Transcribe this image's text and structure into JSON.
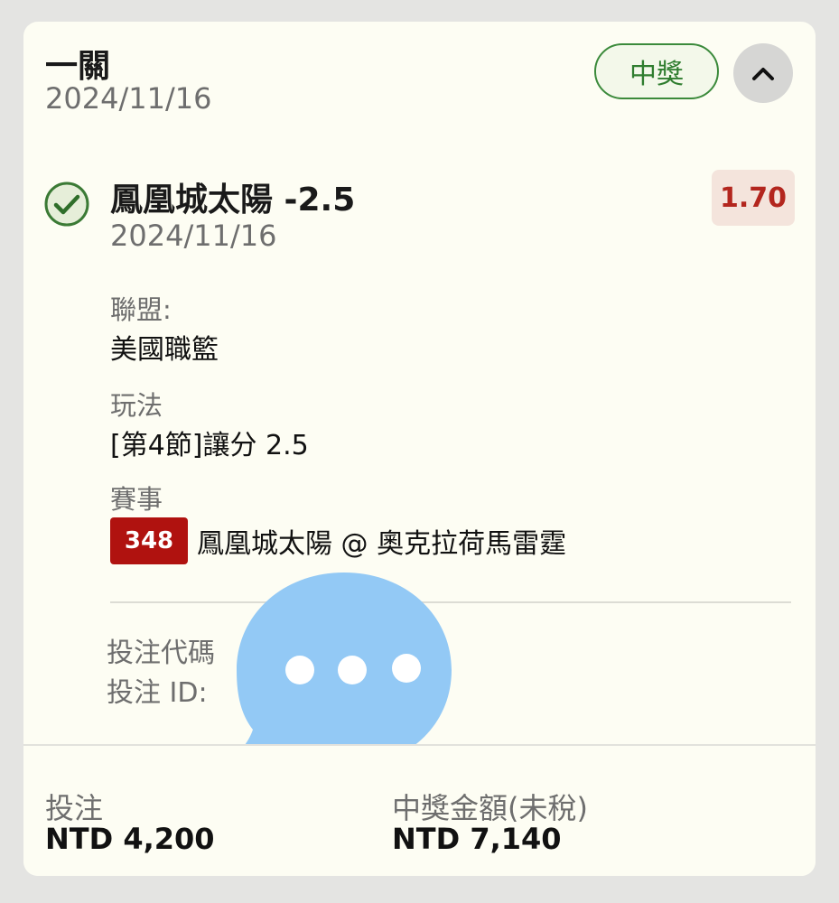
{
  "card": {
    "title": "一關",
    "date": "2024/11/16",
    "status_label": "中獎",
    "collapse_icon": "chevron-up-icon"
  },
  "selection": {
    "status_icon": "check-circle-icon",
    "name": "鳳凰城太陽 -2.5",
    "date": "2024/11/16",
    "odds": "1.70",
    "league_label": "聯盟:",
    "league_value": "美國職籃",
    "market_label": "玩法",
    "market_value": "[第4節]讓分 2.5",
    "event_label": "賽事",
    "event_number": "348",
    "event_name": "鳳凰城太陽 @ 奧克拉荷馬雷霆"
  },
  "bet_info": {
    "code_label": "投注代碼",
    "id_label": "投注 ID:"
  },
  "overlay": {
    "icon": "chat-bubble-ellipsis-icon",
    "color": "#93c9f5"
  },
  "footer": {
    "stake_label": "投注",
    "stake_value": "NTD 4,200",
    "payout_label": "中獎金額(未稅)",
    "payout_value": "NTD 7,140"
  },
  "colors": {
    "win_green": "#2f7d2f",
    "odds_red": "#b3261e",
    "event_badge": "#b0120f",
    "card_bg": "#fdfdf3"
  }
}
